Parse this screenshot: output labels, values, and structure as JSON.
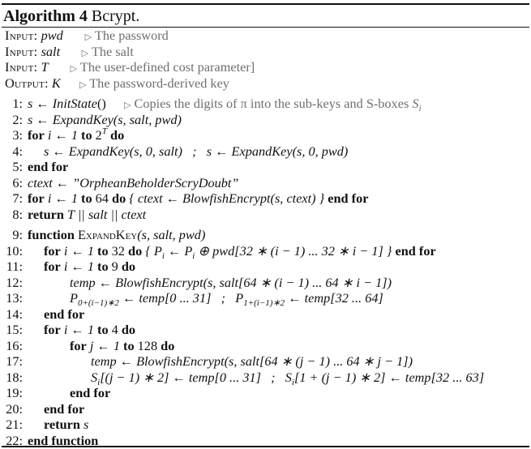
{
  "caption": {
    "label": "Algorithm 4",
    "title": "Bcrypt."
  },
  "io": [
    {
      "kw": "Input:",
      "var": "pwd",
      "comment": "The password"
    },
    {
      "kw": "Input:",
      "var": "salt",
      "comment": "The salt"
    },
    {
      "kw": "Input:",
      "var": "T",
      "comment": "The user-defined cost parameter]"
    },
    {
      "kw": "Output:",
      "var": "K",
      "comment": "The password-derived key"
    }
  ],
  "comment_marker": "▷",
  "lines": {
    "l1": {
      "num": "1:",
      "a": "s ← ",
      "b": "InitState",
      "c": "()",
      "comment": "Copies the digits of π into the sub-keys and S-boxes ",
      "comment_var": "S",
      "comment_sub": "i"
    },
    "l2": {
      "num": "2:",
      "text": "s ← ExpandKey(s, salt, pwd)"
    },
    "l3": {
      "num": "3:",
      "kw1": "for",
      "mid": " i ← 1 ",
      "kw2": "to",
      "base": " 2",
      "sup": "T",
      "kw3": " do"
    },
    "l4": {
      "num": "4:",
      "text": "s ← ExpandKey(s, 0, salt)   ;   s ← ExpandKey(s, 0, pwd)"
    },
    "l5": {
      "num": "5:",
      "kw": "end for"
    },
    "l6": {
      "num": "6:",
      "text": "ctext ← ”OrpheanBeholderScryDoubt”"
    },
    "l7": {
      "num": "7:",
      "kw1": "for",
      "mid1": " i ← 1 ",
      "kw2": "to",
      "mid2": " 64 ",
      "kw3": "do",
      "mid3": " { ctext ← BlowfishEncrypt(s, ctext) } ",
      "kw4": "end for"
    },
    "l8": {
      "num": "8:",
      "kw": "return",
      "text": " T || salt || ctext"
    },
    "l9": {
      "num": "9:",
      "kw": "function",
      "name": " ExpandKey",
      "args": "(s, salt, pwd)"
    },
    "l10": {
      "num": "10:",
      "kw1": "for",
      "mid1": " i ← 1 ",
      "kw2": "to",
      "mid2": " 32 ",
      "kw3": "do",
      "p1": " { P",
      "sub1": "i",
      "p2": " ← P",
      "sub2": "i",
      "p3": " ⊕ pwd[32 ∗ (i − 1) ... 32 ∗ i − 1] } ",
      "kw4": "end for"
    },
    "l11": {
      "num": "11:",
      "kw1": "for",
      "mid": " i ← 1 ",
      "kw2": "to",
      "mid2": " 9 ",
      "kw3": "do"
    },
    "l12": {
      "num": "12:",
      "text": "temp ← BlowfishEncrypt(s, salt[64 ∗ (i − 1) ... 64 ∗ i − 1])"
    },
    "l13": {
      "num": "13:",
      "p1": "P",
      "sub1": "0+(i−1)∗2",
      "p2": " ← temp[0 ... 31]   ;   P",
      "sub2": "1+(i−1)∗2",
      "p3": " ← temp[32 ... 64]"
    },
    "l14": {
      "num": "14:",
      "kw": "end for"
    },
    "l15": {
      "num": "15:",
      "kw1": "for",
      "mid": " i ← 1 ",
      "kw2": "to",
      "mid2": " 4 ",
      "kw3": "do"
    },
    "l16": {
      "num": "16:",
      "kw1": "for",
      "mid": " j ← 1 ",
      "kw2": "to",
      "mid2": " 128 ",
      "kw3": "do"
    },
    "l17": {
      "num": "17:",
      "text": "temp ← BlowfishEncrypt(s, salt[64 ∗ (j − 1) ... 64 ∗ j − 1])"
    },
    "l18": {
      "num": "18:",
      "p1": "S",
      "sub1": "i",
      "p2": "[(j − 1) ∗ 2] ← temp[0 ... 31]   ;   S",
      "sub2": "i",
      "p3": "[1 + (j − 1) ∗ 2] ← temp[32 ... 63]"
    },
    "l19": {
      "num": "19:",
      "kw": "end for"
    },
    "l20": {
      "num": "20:",
      "kw": "end for"
    },
    "l21": {
      "num": "21:",
      "kw": "return",
      "text": " s"
    },
    "l22": {
      "num": "22:",
      "kw": "end function"
    }
  }
}
